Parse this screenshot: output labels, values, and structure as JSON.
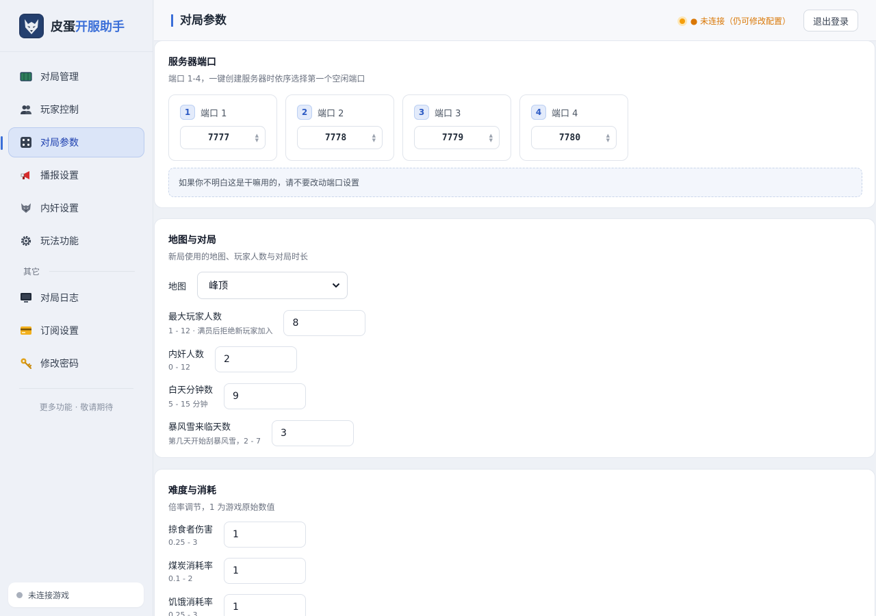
{
  "brand": {
    "name_part1": "皮蛋",
    "name_part2": "开服助手"
  },
  "nav": {
    "items": [
      {
        "label": "对局管理",
        "icon": "map-icon"
      },
      {
        "label": "玩家控制",
        "icon": "users-icon"
      },
      {
        "label": "对局参数",
        "icon": "dice-icon"
      },
      {
        "label": "播报设置",
        "icon": "megaphone-icon"
      },
      {
        "label": "内奸设置",
        "icon": "wolf-icon"
      },
      {
        "label": "玩法功能",
        "icon": "gear-icon"
      }
    ],
    "section_label": "其它",
    "other_items": [
      {
        "label": "对局日志",
        "icon": "monitor-icon"
      },
      {
        "label": "订阅设置",
        "icon": "card-icon"
      },
      {
        "label": "修改密码",
        "icon": "key-icon"
      }
    ],
    "more_hint": "更多功能 · 敬请期待",
    "game_status": "未连接游戏"
  },
  "header": {
    "title": "对局参数",
    "status": "● 未连接（仍可修改配置）",
    "logout_label": "退出登录"
  },
  "ports": {
    "title": "服务器端口",
    "desc": "端口 1-4，一键创建服务器时依序选择第一个空闲端口",
    "items": [
      {
        "num": "1",
        "label": "端口 1",
        "value": "7777"
      },
      {
        "num": "2",
        "label": "端口 2",
        "value": "7778"
      },
      {
        "num": "3",
        "label": "端口 3",
        "value": "7779"
      },
      {
        "num": "4",
        "label": "端口 4",
        "value": "7780"
      }
    ],
    "note": "如果你不明白这是干嘛用的，请不要改动端口设置"
  },
  "map_section": {
    "title": "地图与对局",
    "desc": "新局使用的地图、玩家人数与对局时长",
    "map_label": "地图",
    "map_value": "峰顶",
    "fields": [
      {
        "label": "最大玩家人数",
        "sub": "1 - 12 · 满员后拒绝新玩家加入",
        "value": "8"
      },
      {
        "label": "内奸人数",
        "sub": "0 - 12",
        "value": "2"
      },
      {
        "label": "白天分钟数",
        "sub": "5 - 15 分钟",
        "value": "9"
      },
      {
        "label": "暴风雪来临天数",
        "sub": "第几天开始刮暴风雪，2 - 7",
        "value": "3"
      }
    ]
  },
  "difficulty": {
    "title": "难度与消耗",
    "desc": "倍率调节，1 为游戏原始数值",
    "fields": [
      {
        "label": "掠食者伤害",
        "sub": "0.25 - 3",
        "value": "1"
      },
      {
        "label": "煤炭消耗率",
        "sub": "0.1 - 2",
        "value": "1"
      },
      {
        "label": "饥饿消耗率",
        "sub": "0.25 - 3",
        "value": "1"
      }
    ]
  }
}
